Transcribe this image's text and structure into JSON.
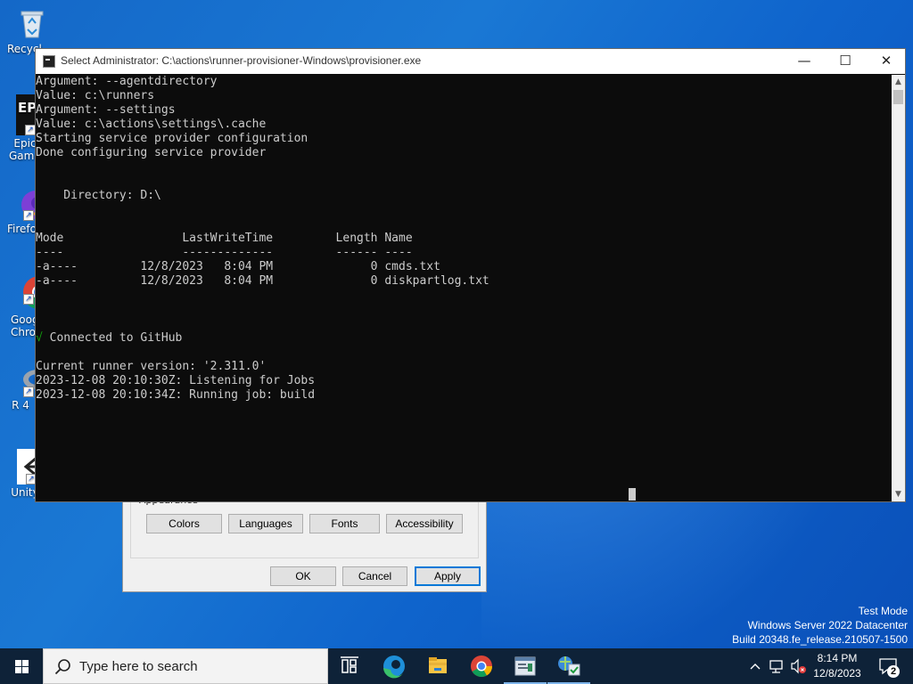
{
  "desktop": {
    "icons": [
      {
        "label": "Recycle Bin"
      },
      {
        "label": "Epic Games Launcher"
      },
      {
        "label": "Firefox"
      },
      {
        "label": "Google Chrome"
      },
      {
        "label": "R 4"
      },
      {
        "label": "Unity Hub"
      }
    ]
  },
  "dialog": {
    "group_title": "Appearance",
    "buttons": {
      "colors": "Colors",
      "languages": "Languages",
      "fonts": "Fonts",
      "accessibility": "Accessibility",
      "ok": "OK",
      "cancel": "Cancel",
      "apply": "Apply"
    }
  },
  "console": {
    "title": "Select Administrator: C:\\actions\\runner-provisioner-Windows\\provisioner.exe",
    "controls": {
      "minimize": "—",
      "maximize": "☐",
      "close": "✕"
    },
    "lines": [
      "Argument: --agentdirectory",
      "Value: c:\\runners",
      "Argument: --settings",
      "Value: c:\\actions\\settings\\.cache",
      "Starting service provider configuration",
      "Done configuring service provider",
      "",
      "",
      "    Directory: D:\\",
      "",
      "",
      "Mode                 LastWriteTime         Length Name",
      "----                 -------------         ------ ----",
      "-a----         12/8/2023   8:04 PM              0 cmds.txt",
      "-a----         12/8/2023   8:04 PM              0 diskpartlog.txt",
      "",
      "",
      "",
      "",
      "Current runner version: '2.311.0'",
      "2023-12-08 20:10:30Z: Listening for Jobs",
      "2023-12-08 20:10:34Z: Running job: build"
    ],
    "connected": {
      "mark": "√",
      "text": " Connected to GitHub"
    }
  },
  "watermark": {
    "line1": "Test Mode",
    "line2": "Windows Server 2022 Datacenter",
    "line3": "Build 20348.fe_release.210507-1500"
  },
  "taskbar": {
    "search_placeholder": "Type here to search",
    "apps": [
      "task-view-icon",
      "edge-icon",
      "file-explorer-icon",
      "chrome-icon",
      "app-window-icon",
      "server-manager-icon"
    ],
    "tray": {
      "time": "8:14 PM",
      "date": "12/8/2023",
      "notifications": "2"
    }
  }
}
